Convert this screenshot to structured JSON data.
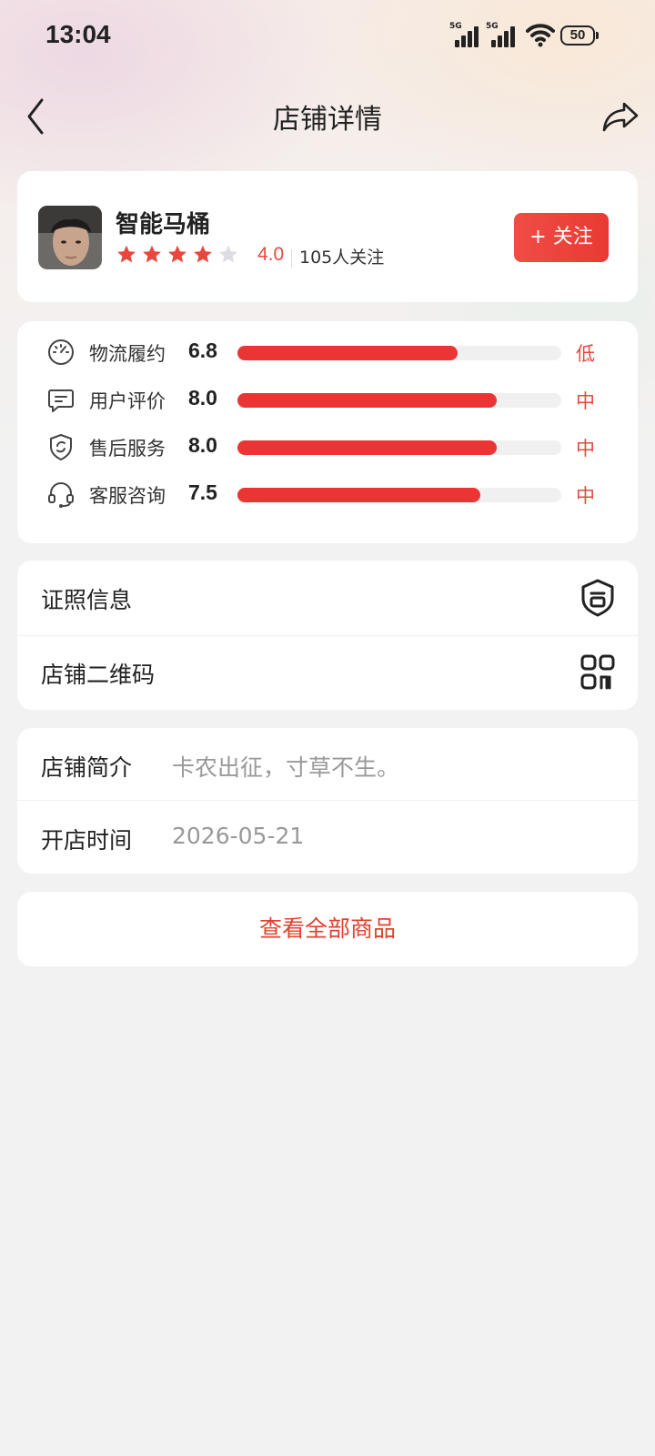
{
  "status_bar": {
    "time": "13:04",
    "signal1_label": "5G",
    "signal2_label": "5G",
    "battery": "50"
  },
  "header": {
    "title": "店铺详情",
    "back_icon": "chevron-left-icon",
    "share_icon": "share-arrow-icon"
  },
  "shop": {
    "name": "智能马桶",
    "rating": "4.0",
    "rating_value": 4.0,
    "max_stars": 5,
    "followers": "105人关注",
    "follow_button": "+ 关注"
  },
  "scores": [
    {
      "icon": "speedometer-icon",
      "label": "物流履约",
      "value": "6.8",
      "fraction": 0.68,
      "level": "低"
    },
    {
      "icon": "comment-icon",
      "label": "用户评价",
      "value": "8.0",
      "fraction": 0.8,
      "level": "中"
    },
    {
      "icon": "shield-refresh-icon",
      "label": "售后服务",
      "value": "8.0",
      "fraction": 0.8,
      "level": "中"
    },
    {
      "icon": "headset-icon",
      "label": "客服咨询",
      "value": "7.5",
      "fraction": 0.75,
      "level": "中"
    }
  ],
  "links": [
    {
      "label": "证照信息",
      "icon": "license-badge-icon"
    },
    {
      "label": "店铺二维码",
      "icon": "qr-code-icon"
    }
  ],
  "info": [
    {
      "key": "店铺简介",
      "value": "卡农出征，寸草不生。"
    },
    {
      "key": "开店时间",
      "value": "2026-05-21"
    }
  ],
  "view_all": "查看全部商品",
  "colors": {
    "accent": "#e8473d",
    "bar": "#ea3534",
    "track": "#f0f0f0",
    "star_empty": "#dcdce2"
  }
}
